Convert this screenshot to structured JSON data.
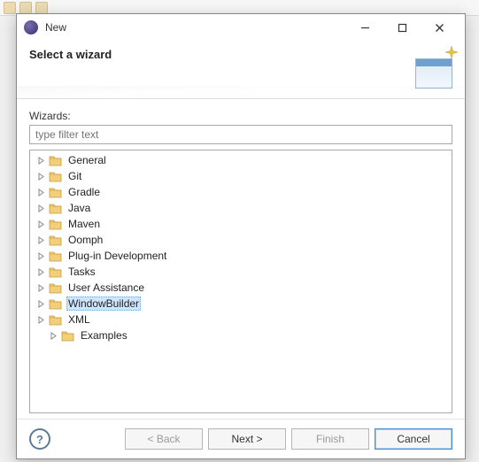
{
  "titlebar": {
    "title": "New"
  },
  "header": {
    "title": "Select a wizard"
  },
  "body": {
    "wizards_label": "Wizards:",
    "filter_placeholder": "type filter text"
  },
  "tree": {
    "items": [
      {
        "label": "General",
        "selected": false,
        "expanded": false,
        "indent": 0
      },
      {
        "label": "Git",
        "selected": false,
        "expanded": false,
        "indent": 0
      },
      {
        "label": "Gradle",
        "selected": false,
        "expanded": false,
        "indent": 0
      },
      {
        "label": "Java",
        "selected": false,
        "expanded": false,
        "indent": 0
      },
      {
        "label": "Maven",
        "selected": false,
        "expanded": false,
        "indent": 0
      },
      {
        "label": "Oomph",
        "selected": false,
        "expanded": false,
        "indent": 0
      },
      {
        "label": "Plug-in Development",
        "selected": false,
        "expanded": false,
        "indent": 0
      },
      {
        "label": "Tasks",
        "selected": false,
        "expanded": false,
        "indent": 0
      },
      {
        "label": "User Assistance",
        "selected": false,
        "expanded": false,
        "indent": 0
      },
      {
        "label": "WindowBuilder",
        "selected": true,
        "expanded": false,
        "indent": 0
      },
      {
        "label": "XML",
        "selected": false,
        "expanded": false,
        "indent": 0
      },
      {
        "label": "Examples",
        "selected": false,
        "expanded": false,
        "indent": 1
      }
    ]
  },
  "buttons": {
    "back": "< Back",
    "next": "Next >",
    "finish": "Finish",
    "cancel": "Cancel"
  },
  "icons": {
    "folder_fill": "#f4cf7a",
    "folder_stroke": "#c69a3a"
  }
}
